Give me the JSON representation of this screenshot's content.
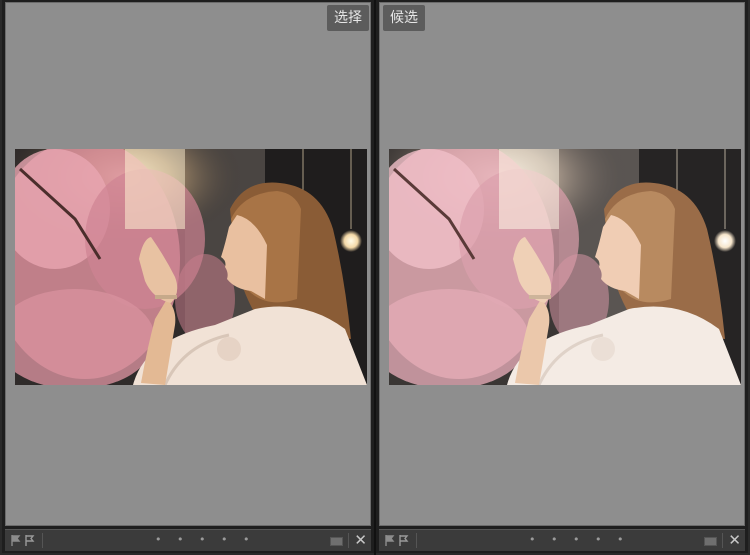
{
  "panes": {
    "left": {
      "label": "选择"
    },
    "right": {
      "label": "候选"
    }
  },
  "footer": {
    "rating_dots": "• • • • •",
    "close_symbol": "✕"
  },
  "colors": {
    "canvas_bg": "#8e8e8e",
    "label_bg": "#5c5c5c",
    "footer_bg": "#3b3b3b"
  },
  "icons": [
    "flag-icon",
    "pick-flag-icon",
    "color-label-icon",
    "close-icon"
  ]
}
